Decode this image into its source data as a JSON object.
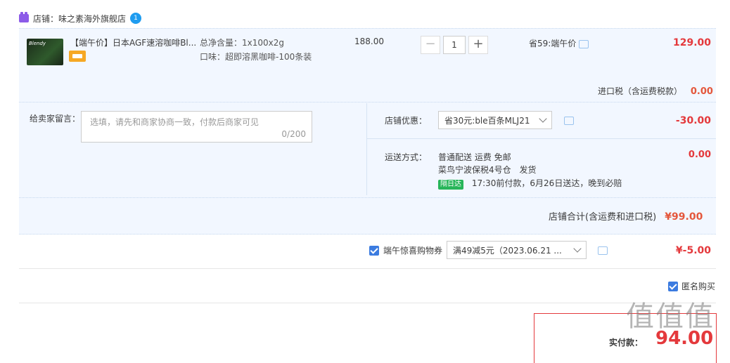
{
  "shop": {
    "label": "店铺：味之素海外旗舰店",
    "chat_badge": "1"
  },
  "item": {
    "image_label": "Blendy",
    "title": "【端午价】日本AGF速溶咖啡Bl...",
    "spec1": "总净含量：1x100x2g",
    "spec2": "口味：超即溶黑咖啡-100条装",
    "original_price": "188.00",
    "quantity": "1",
    "minus": "−",
    "plus": "+",
    "saving": "省59:端午价",
    "price": "129.00"
  },
  "import_tax": {
    "label": "进口税（含运费税款）",
    "value": "0.00"
  },
  "note": {
    "label": "给卖家留言：",
    "placeholder": "选填，请先和商家协商一致，付款后商家可见",
    "count": "0/200"
  },
  "shop_discount": {
    "label": "店铺优惠：",
    "selected": "省30元:ble百条MLJ21",
    "value": "-30.00"
  },
  "shipping": {
    "label": "运送方式：",
    "method": "普通配送 运费 免邮",
    "warehouse": "菜鸟宁波保税4号仓",
    "ship_note": "发货",
    "badge": "隔日达",
    "delivery": "17:30前付款，6月26日送达，晚到必赔",
    "value": "0.00"
  },
  "subtotal": {
    "label": "店铺合计(含运费和进口税)",
    "value": "¥99.00"
  },
  "coupon": {
    "label": "端午惊喜购物券",
    "selected": "满49减5元（2023.06.21 ...",
    "value": "¥-5.00"
  },
  "anonymous": {
    "label": "匿名购买"
  },
  "payment": {
    "label": "实付款：",
    "value": "94.00"
  },
  "watermark": "值值值"
}
